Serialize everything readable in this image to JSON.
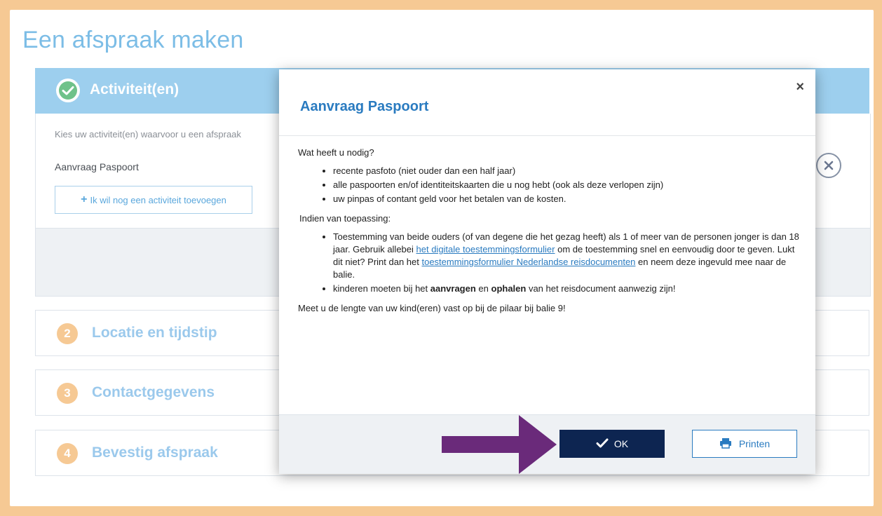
{
  "page": {
    "title": "Een afspraak maken"
  },
  "step1": {
    "title": "Activiteit(en)",
    "instruction": "Kies uw activiteit(en) waarvoor u een afspraak",
    "activity": "Aanvraag Paspoort",
    "add_button": "Ik wil nog een activiteit toevoegen"
  },
  "steps": [
    {
      "number": "2",
      "label": "Locatie en tijdstip"
    },
    {
      "number": "3",
      "label": "Contactgegevens"
    },
    {
      "number": "4",
      "label": "Bevestig afspraak"
    }
  ],
  "modal": {
    "title": "Aanvraag Paspoort",
    "close": "×",
    "intro": "Wat heeft u nodig?",
    "needs": [
      "recente pasfoto (niet ouder dan een half jaar)",
      "alle paspoorten en/of identiteitskaarten die u nog hebt (ook als deze verlopen zijn)",
      "uw pinpas of contant geld voor het betalen van de kosten."
    ],
    "applicable_heading": "Indien van toepassing:",
    "consent": {
      "part1": "Toestemming van beide ouders (of van degene die het gezag heeft) als 1 of meer van de personen jonger is dan 18 jaar. Gebruik allebei ",
      "link1": "het digitale toestemmingsformulier",
      "part2": " om de toestemming snel en eenvoudig door te geven. Lukt dit niet? Print dan het ",
      "link2": "toestemmingsformulier Nederlandse reisdocumenten",
      "part3": " en neem deze ingevuld mee naar de balie."
    },
    "children": {
      "part1": "kinderen moeten bij het ",
      "bold1": "aanvragen",
      "part2": " en ",
      "bold2": "ophalen",
      "part3": " van het reisdocument aanwezig zijn!"
    },
    "closing": "Meet u de lengte van uw kind(eren) vast op bij de pilaar bij balie 9!",
    "ok_button": "OK",
    "print_button": "Printen"
  },
  "colors": {
    "border_frame": "#f6c994",
    "accent_blue": "#2a7bc0",
    "step_header": "#9dcfee",
    "ok_button": "#0d2551",
    "arrow": "#6a2a7a"
  },
  "icons": {
    "check": "check-circle-icon",
    "plus": "plus-icon",
    "remove": "remove-circle-icon",
    "close": "close-icon",
    "ok": "checkmark-icon",
    "print": "printer-icon",
    "arrow": "arrow-right-icon"
  }
}
